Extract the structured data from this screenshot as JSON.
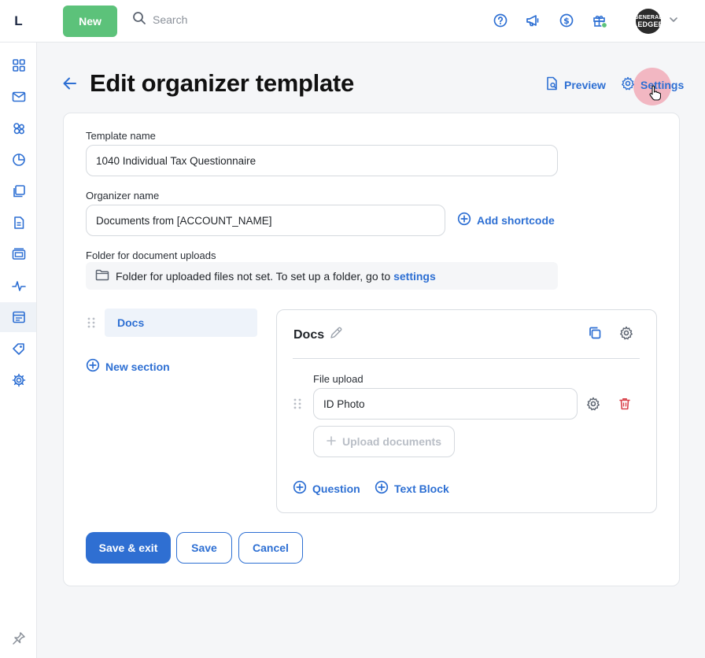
{
  "app": {
    "logo": "L"
  },
  "topbar": {
    "new_label": "New",
    "search_placeholder": "Search",
    "icons": [
      "help-circle-icon",
      "megaphone-icon",
      "dollar-icon",
      "gift-icon"
    ],
    "avatar_text_1": "GENERAL",
    "avatar_text_2": "LEDGER"
  },
  "sidebar": {
    "items": [
      "dashboard-icon",
      "inbox-icon",
      "clients-icon",
      "insights-icon",
      "documents-icon",
      "templates-icon",
      "billing-icon",
      "activity-icon",
      "organizers-icon",
      "marketplace-icon",
      "settings-icon"
    ],
    "active": "organizers-icon",
    "pin_icon": "pin-icon"
  },
  "header": {
    "title": "Edit organizer template",
    "preview_label": "Preview",
    "settings_label": "Settings"
  },
  "form": {
    "template_name_label": "Template name",
    "template_name_value": "1040 Individual Tax Questionnaire",
    "organizer_name_label": "Organizer name",
    "organizer_name_value": "Documents from [ACCOUNT_NAME]",
    "add_shortcode_label": "Add shortcode",
    "folder_label": "Folder for document uploads",
    "folder_text": "Folder for uploaded files not set. To set up a folder, go to",
    "folder_link": "settings"
  },
  "sections": {
    "items": [
      {
        "label": "Docs"
      }
    ],
    "new_section_label": "New section"
  },
  "section_panel": {
    "title": "Docs",
    "field_label": "File upload",
    "field_value": "ID Photo",
    "upload_label": "Upload documents",
    "add_question_label": "Question",
    "add_text_block_label": "Text Block"
  },
  "actions": {
    "save_exit_label": "Save & exit",
    "save_label": "Save",
    "cancel_label": "Cancel"
  },
  "colors": {
    "accent": "#2d6fd3",
    "new_button": "#5cc27a",
    "danger": "#d9434b"
  }
}
